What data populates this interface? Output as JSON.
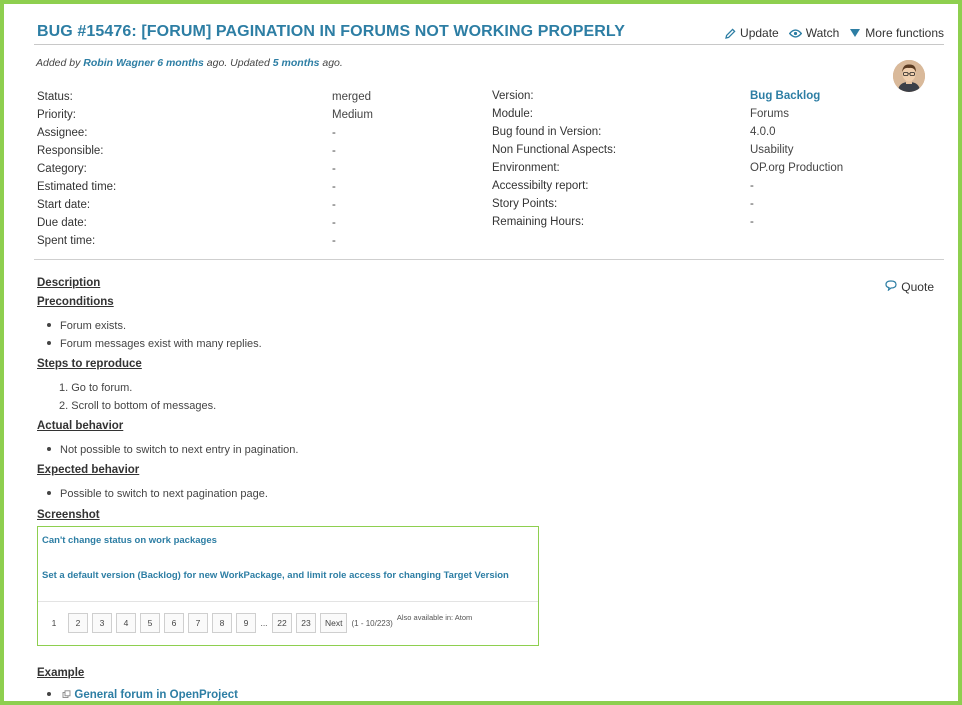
{
  "header": {
    "title": "BUG #15476: [FORUM] PAGINATION IN FORUMS NOT WORKING PROPERLY",
    "actions": {
      "update": "Update",
      "watch": "Watch",
      "more": "More functions"
    }
  },
  "meta": {
    "added_by_prefix": "Added by",
    "author": "Robin Wagner",
    "created_ago": "6 months",
    "ago_updated": "ago. Updated",
    "updated_ago": "5 months",
    "ago_end": "ago."
  },
  "attributes_left": [
    {
      "label": "Status:",
      "value": "merged"
    },
    {
      "label": "Priority:",
      "value": "Medium"
    },
    {
      "label": "Assignee:",
      "value": "-"
    },
    {
      "label": "Responsible:",
      "value": "-"
    },
    {
      "label": "Category:",
      "value": "-"
    },
    {
      "label": "Estimated time:",
      "value": "-"
    },
    {
      "label": "Start date:",
      "value": "-"
    },
    {
      "label": "Due date:",
      "value": "-"
    },
    {
      "label": "Spent time:",
      "value": "-"
    }
  ],
  "attributes_right": [
    {
      "label": "Version:",
      "value": "Bug Backlog"
    },
    {
      "label": "Module:",
      "value": "Forums"
    },
    {
      "label": "Bug found in Version:",
      "value": "4.0.0"
    },
    {
      "label": "Non Functional Aspects:",
      "value": "Usability"
    },
    {
      "label": "Environment:",
      "value": "OP.org Production"
    },
    {
      "label": "Accessibilty report:",
      "value": "-"
    },
    {
      "label": "Story Points:",
      "value": "-"
    },
    {
      "label": "Remaining Hours:",
      "value": "-"
    }
  ],
  "description": {
    "heading": "Description",
    "quote": "Quote",
    "preconditions_heading": "Preconditions",
    "preconditions": [
      "Forum exists.",
      "Forum messages exist with many replies."
    ],
    "steps_heading": "Steps to reproduce",
    "steps": [
      "1. Go to forum.",
      "2. Scroll to bottom of messages."
    ],
    "actual_heading": "Actual behavior",
    "actual": [
      "Not possible to switch to next entry in pagination."
    ],
    "expected_heading": "Expected behavior",
    "expected": [
      "Possible to switch to next pagination page."
    ],
    "screenshot_heading": "Screenshot",
    "example_heading": "Example",
    "example_link": "General forum in OpenProject"
  },
  "screenshot": {
    "link1": "Can't change status on work packages",
    "link2": "Set a default version (Backlog) for new WorkPackage, and limit role access for changing Target Version",
    "pages": [
      "1",
      "2",
      "3",
      "4",
      "5",
      "6",
      "7",
      "8",
      "9",
      "...",
      "22",
      "23",
      "Next"
    ],
    "range": "(1 - 10/223)",
    "also": "Also available in: Atom"
  },
  "colors": {
    "accent": "#2d7ea4",
    "frame": "#8ecf4f"
  }
}
